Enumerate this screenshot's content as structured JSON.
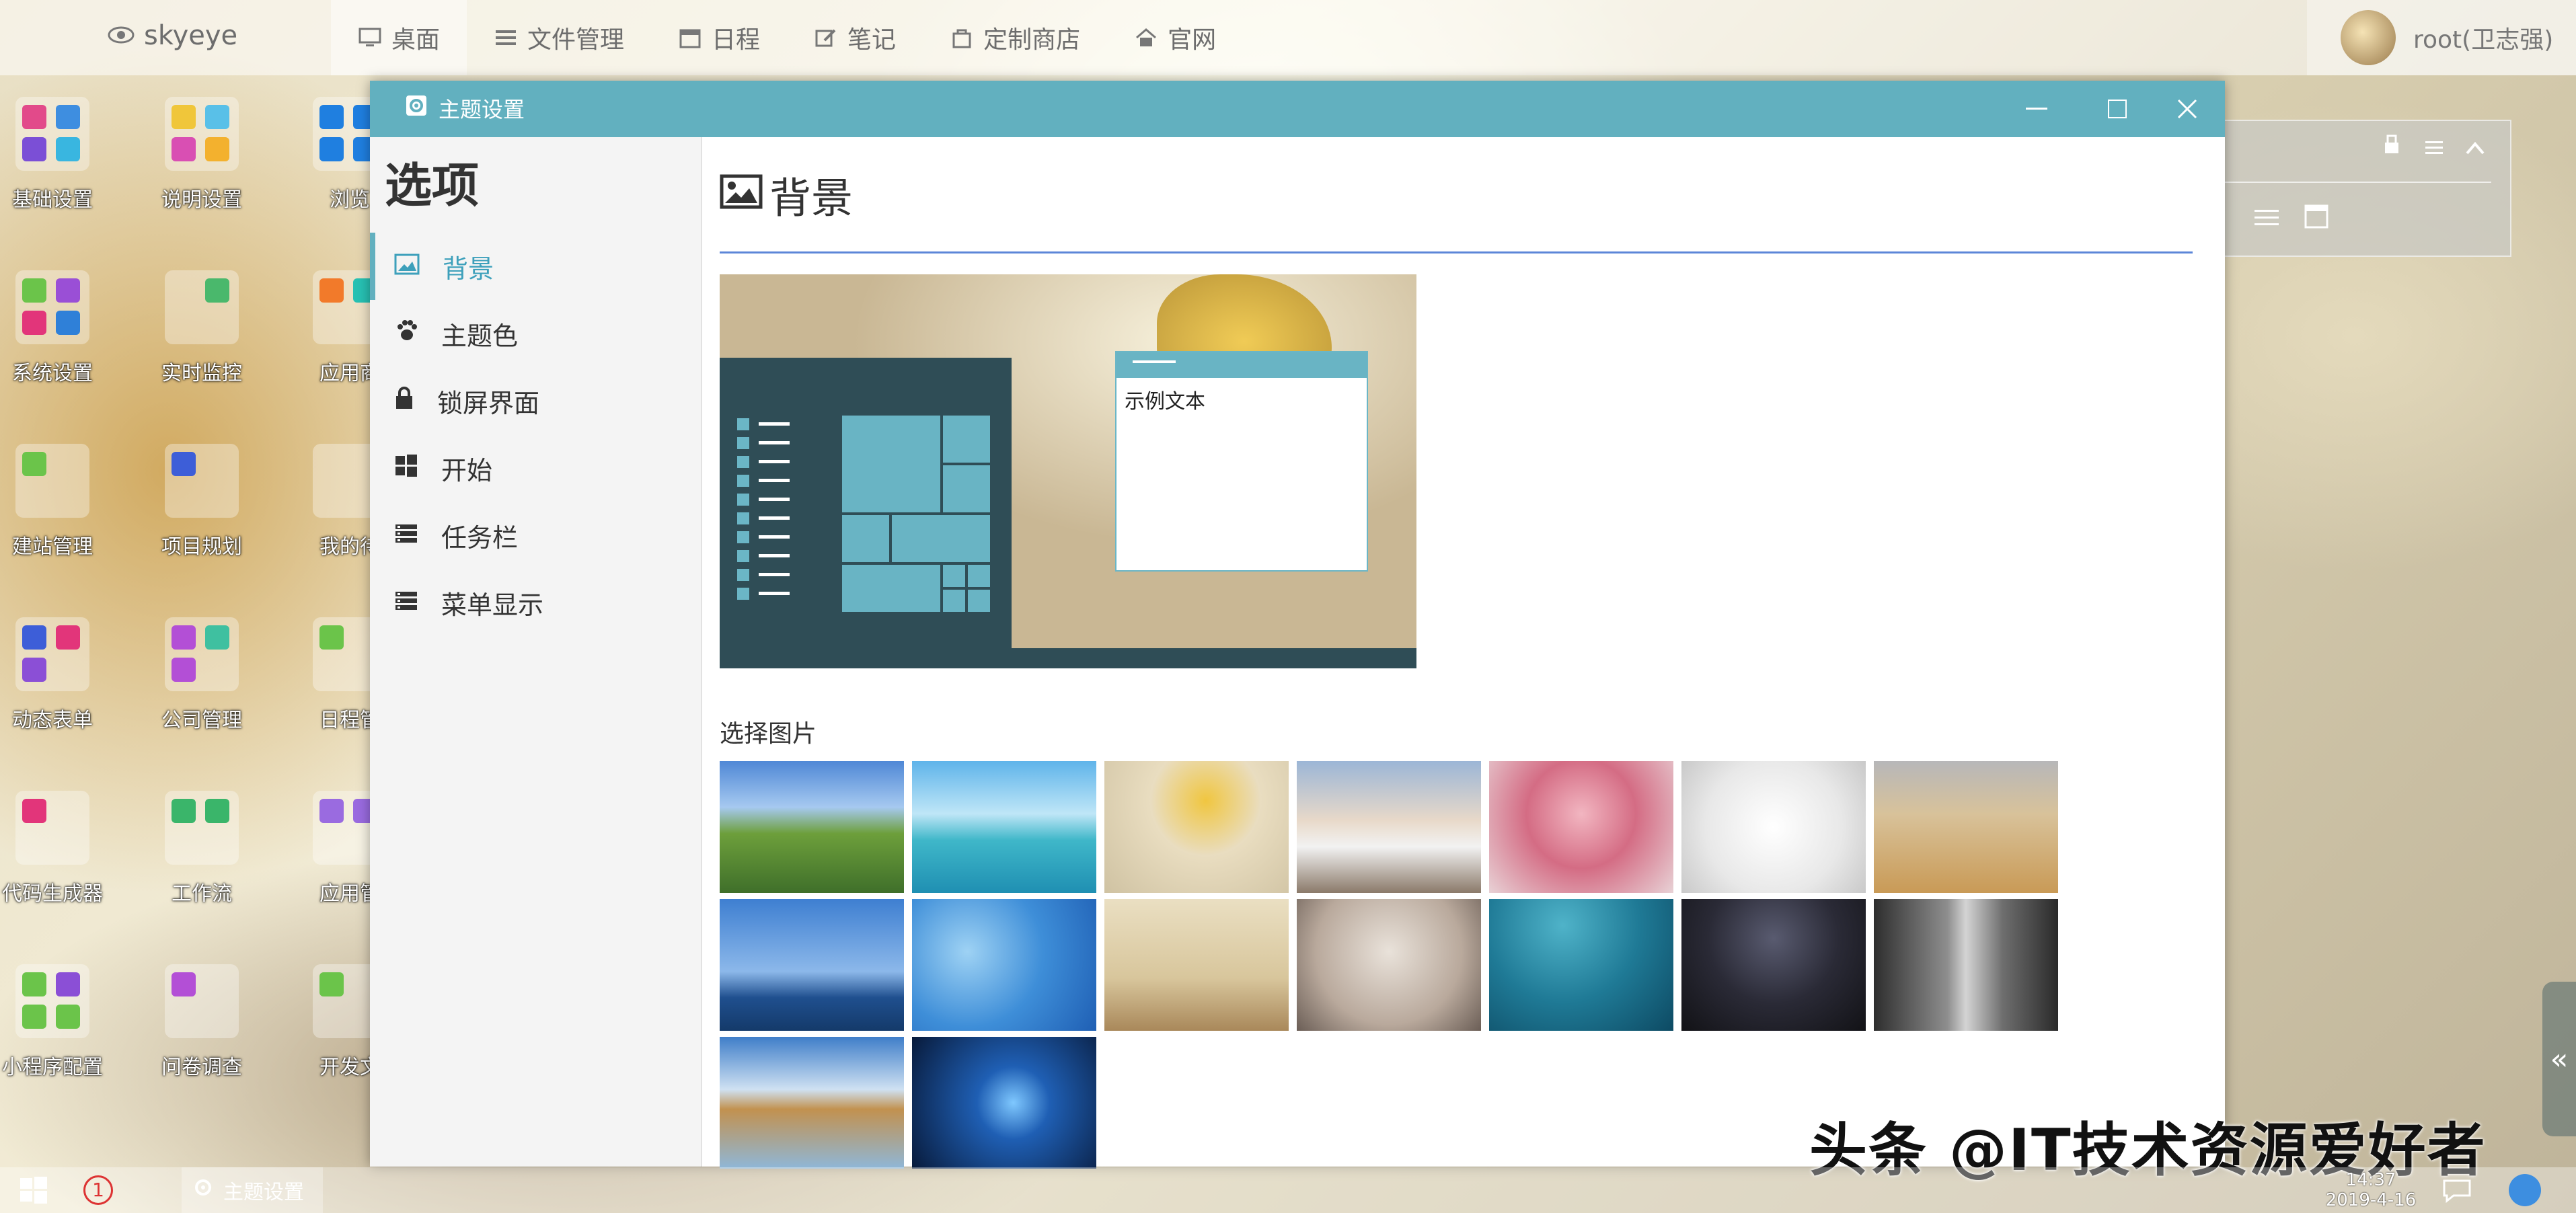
{
  "top_bar": {
    "brand": "skyeye",
    "nav": [
      {
        "label": "桌面",
        "icon": "monitor-icon"
      },
      {
        "label": "文件管理",
        "icon": "list-icon"
      },
      {
        "label": "日程",
        "icon": "calendar-icon"
      },
      {
        "label": "笔记",
        "icon": "pen-icon"
      },
      {
        "label": "定制商店",
        "icon": "bag-icon"
      },
      {
        "label": "官网",
        "icon": "home-icon"
      }
    ],
    "user": "root(卫志强)"
  },
  "desktop_icons": [
    {
      "label": "基础设置"
    },
    {
      "label": "说明设置"
    },
    {
      "label": "浏览"
    },
    {
      "label": "系统设置"
    },
    {
      "label": "实时监控"
    },
    {
      "label": "应用商"
    },
    {
      "label": "建站管理"
    },
    {
      "label": "项目规划"
    },
    {
      "label": "我的待"
    },
    {
      "label": "动态表单"
    },
    {
      "label": "公司管理"
    },
    {
      "label": "日程管"
    },
    {
      "label": "代码生成器"
    },
    {
      "label": "工作流"
    },
    {
      "label": "应用管"
    },
    {
      "label": "小程序配置"
    },
    {
      "label": "问卷调查"
    },
    {
      "label": "开发文"
    }
  ],
  "window": {
    "title": "主题设置",
    "sidebar_title": "选项",
    "menu": [
      {
        "label": "背景",
        "icon": "image-icon",
        "active": true
      },
      {
        "label": "主题色",
        "icon": "paw-icon",
        "active": false
      },
      {
        "label": "锁屏界面",
        "icon": "lock-icon",
        "active": false
      },
      {
        "label": "开始",
        "icon": "windows-icon",
        "active": false
      },
      {
        "label": "任务栏",
        "icon": "taskbar-icon",
        "active": false
      },
      {
        "label": "菜单显示",
        "icon": "menu-display-icon",
        "active": false
      }
    ],
    "section_title": "背景",
    "preview_text": "示例文本",
    "choose_label": "选择图片",
    "thumbnails": [
      "grassland-lake",
      "tropical-beach",
      "autumn-leaf-cup",
      "snowy-boardwalk",
      "pink-blossom-tree",
      "ink-bird-branch",
      "wheat-field",
      "sailing-ship",
      "blue-swirl",
      "sepia-landscape",
      "woman-on-bed",
      "underwater-diver",
      "milky-way-tent",
      "grey-waterfall",
      "sea-rocks-reflection",
      "windows-logo-blue"
    ]
  },
  "taskbar": {
    "badge": "1",
    "app": "主题设置",
    "time": "14:37",
    "date": "2019-4-16"
  },
  "watermark": "头条 @IT技术资源爱好者",
  "colors": {
    "accent": "#62b0bf",
    "active_menu": "#3da0bb",
    "rule": "#5c86d8",
    "preview_dark": "#2f4d56"
  }
}
